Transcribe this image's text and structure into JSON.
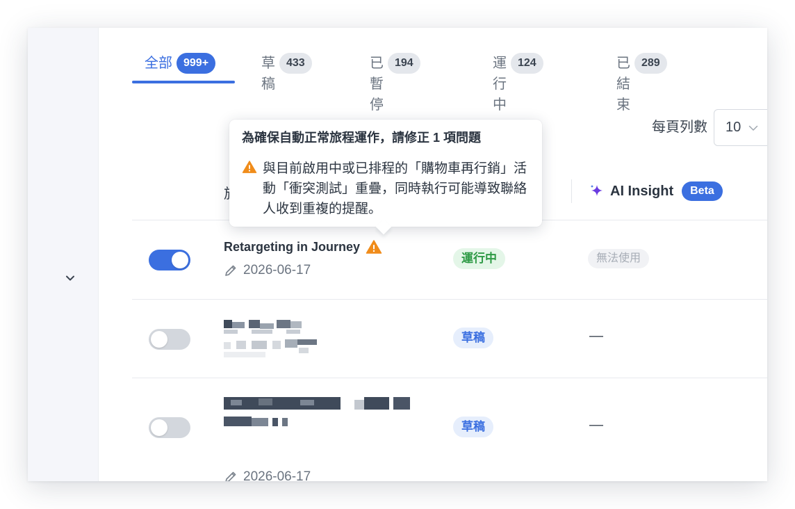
{
  "tabs": [
    {
      "label": "全部",
      "count": "999+",
      "active": true
    },
    {
      "label": "草稿",
      "count": "433"
    },
    {
      "label": "已暫停",
      "count": "194"
    },
    {
      "label": "運行中",
      "count": "124"
    },
    {
      "label": "已結束",
      "count": "289"
    }
  ],
  "pagination": {
    "per_page_label": "每頁列數",
    "per_page_value": "10"
  },
  "table_header": {
    "name_partial": "旅",
    "ai_insight": "AI Insight",
    "beta": "Beta"
  },
  "tooltip": {
    "title": "為確保自動正常旅程運作，請修正 1 項問題",
    "message": "與目前啟用中或已排程的「購物車再行銷」活動「衝突測試」重疊，同時執行可能導致聯絡人收到重複的提醒。"
  },
  "rows": [
    {
      "enabled": true,
      "name": "Retargeting in Journey",
      "date": "2026-06-17",
      "status": "運行中",
      "ai": "無法使用"
    },
    {
      "enabled": false,
      "status": "草稿",
      "ai": "—"
    },
    {
      "enabled": false,
      "date": "2026-06-17",
      "status": "草稿",
      "ai": "—"
    }
  ],
  "colors": {
    "accent": "#3b6fe0",
    "running": "#2e9a45",
    "warning": "#f08c1a",
    "sparkle": "#6a3ce0"
  }
}
